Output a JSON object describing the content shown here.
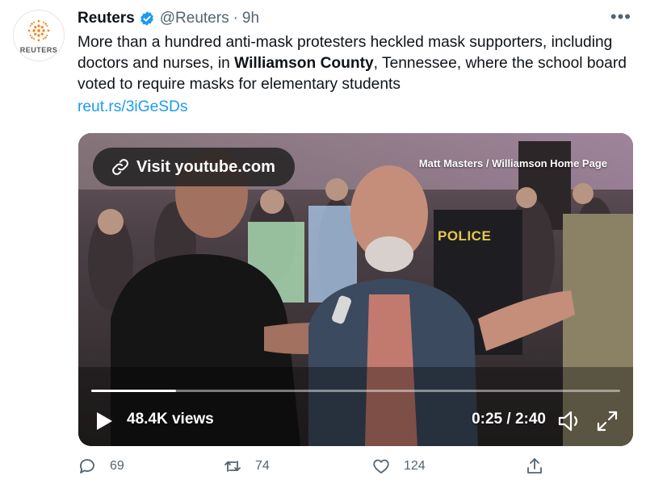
{
  "author": {
    "name": "Reuters",
    "handle": "@Reuters",
    "separator": "·",
    "time": "9h",
    "logo_wordmark": "REUTERS"
  },
  "tweet": {
    "text_before": "More than a hundred anti-mask protesters heckled mask supporters, including doctors and nurses, in ",
    "text_bold": "Williamson County",
    "text_after": ", Tennessee, where the school board voted to require masks for elementary students",
    "link": "reut.rs/3iGeSDs"
  },
  "video": {
    "visit_label": "Visit youtube.com",
    "credit": "Matt Masters / Williamson Home Page",
    "scene_text": "POLICE",
    "views": "48.4K views",
    "timecode": "0:25 / 2:40",
    "progress": 0.16
  },
  "actions": {
    "replies": "69",
    "retweets": "74",
    "likes": "124"
  },
  "colors": {
    "accent": "#1d9bf0",
    "muted": "#536471",
    "text": "#0f1419"
  },
  "icons": [
    "reuters-logo-icon",
    "verified-badge-icon",
    "more-icon",
    "link-icon",
    "play-icon",
    "volume-icon",
    "expand-icon",
    "reply-icon",
    "retweet-icon",
    "like-icon",
    "share-icon"
  ]
}
